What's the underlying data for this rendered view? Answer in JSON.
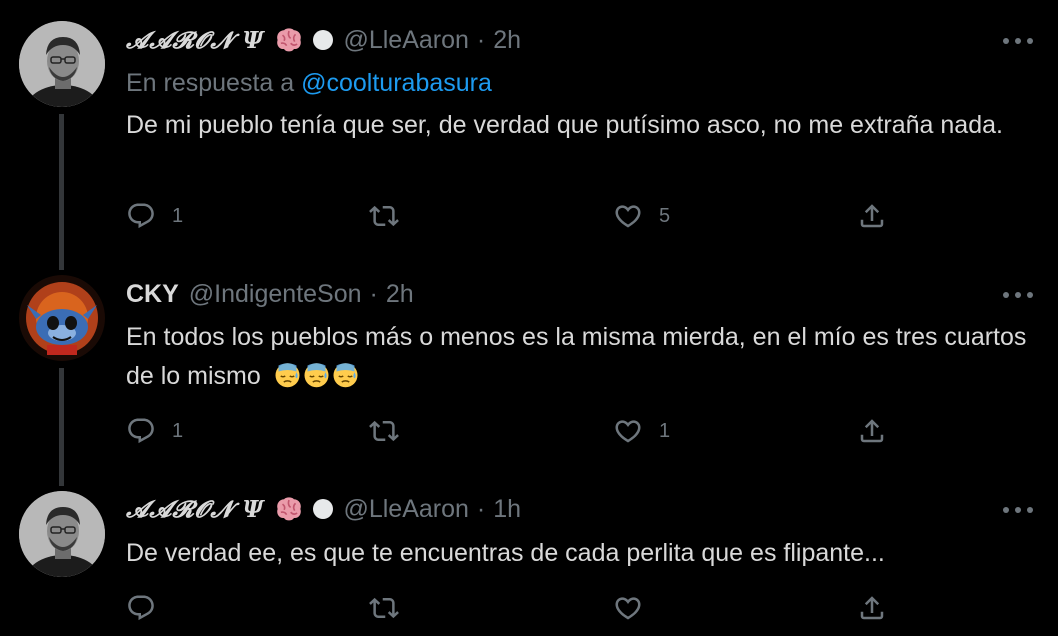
{
  "colors": {
    "background": "#000000",
    "text": "#d9d9d9",
    "muted": "#6e767d",
    "mention": "#1d9bf0",
    "thread_line": "#333639"
  },
  "tweets": [
    {
      "display_name": "𝓐𝓐𝓡𝓞𝓝 Ψ",
      "badges": [
        "brain-emoji",
        "white-circle"
      ],
      "handle": "@LleAaron",
      "separator": "·",
      "time": "2h",
      "reply_prefix": "En respuesta a",
      "reply_mention": "@coolturabasura",
      "text": "De mi pueblo tenía que ser, de verdad que putísimo asco, no me extraña nada.",
      "reply_count": "1",
      "retweet_count": "",
      "like_count": "5"
    },
    {
      "display_name": "CKY",
      "handle": "@IndigenteSon",
      "separator": "·",
      "time": "2h",
      "text": "En todos los pueblos más o menos es la misma mierda, en el mío es tres cuartos de lo mismo",
      "emojis": [
        "downcast-sweat-face",
        "downcast-sweat-face",
        "downcast-sweat-face"
      ],
      "reply_count": "1",
      "retweet_count": "",
      "like_count": "1"
    },
    {
      "display_name": "𝓐𝓐𝓡𝓞𝓝 Ψ",
      "badges": [
        "brain-emoji",
        "white-circle"
      ],
      "handle": "@LleAaron",
      "separator": "·",
      "time": "1h",
      "text": "De verdad ee, es que te encuentras de cada perlita que es flipante...",
      "reply_count": "",
      "retweet_count": "",
      "like_count": ""
    }
  ]
}
